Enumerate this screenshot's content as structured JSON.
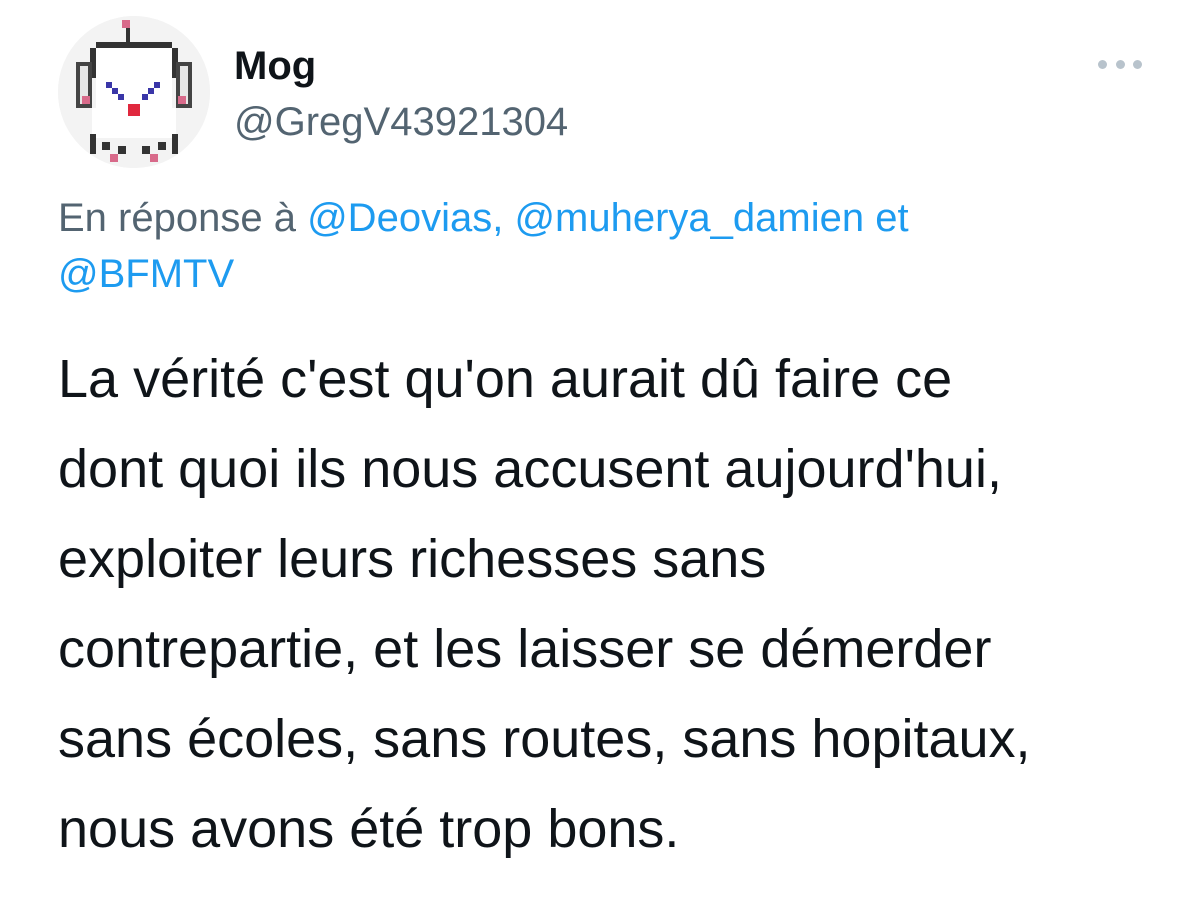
{
  "user": {
    "display_name": "Mog",
    "handle": "@GregV43921304"
  },
  "more_button": {
    "icon": "more-horizontal-icon"
  },
  "reply": {
    "prefix": "En réponse à",
    "mention_1": "@Deovias,",
    "mention_2": "@muherya_damien",
    "conjunction": "et",
    "mention_3": "@BFMTV"
  },
  "tweet": {
    "lines": [
      "La vérité c'est qu'on aurait dû faire ce",
      "dont quoi ils nous accusent aujourd'hui,",
      "exploiter leurs richesses sans",
      "contrepartie, et les laisser se démerder",
      "sans écoles, sans routes, sans hopitaux,",
      "nous avons été trop bons."
    ]
  },
  "colors": {
    "text": "#0f1419",
    "secondary": "#536471",
    "link": "#1d9bf0"
  }
}
